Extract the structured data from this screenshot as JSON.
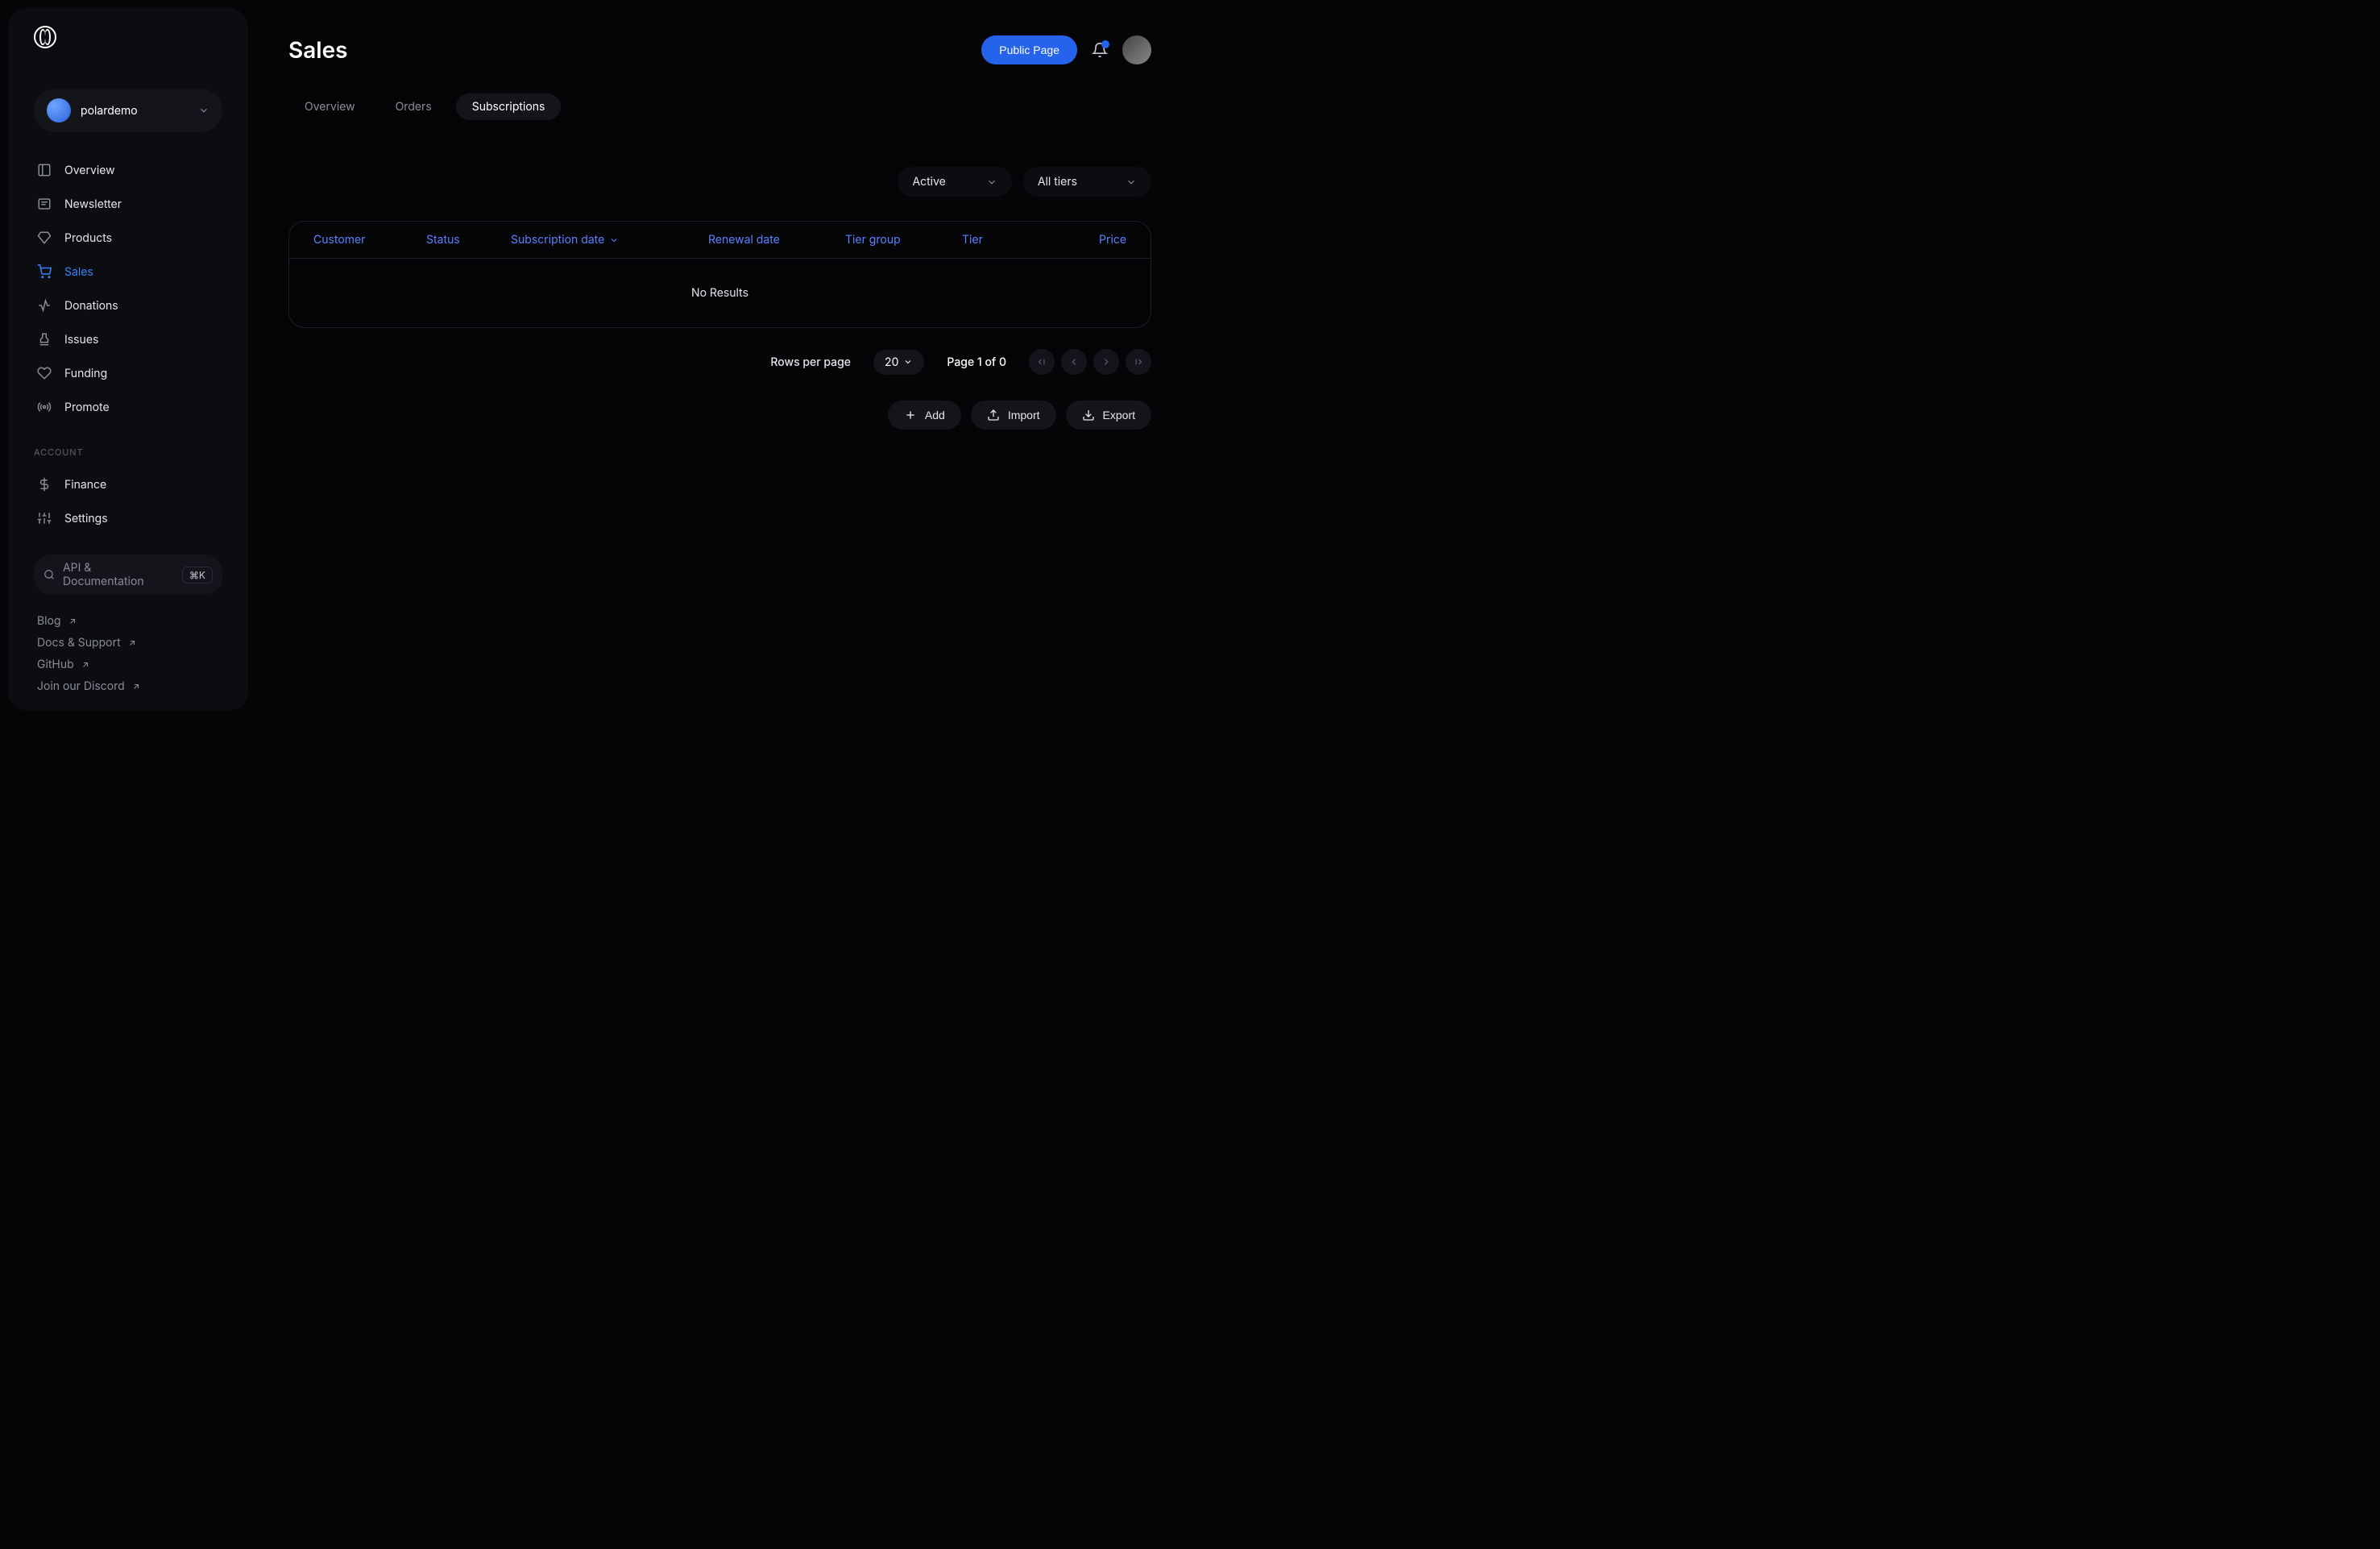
{
  "org_name": "polardemo",
  "sidebar": {
    "nav": [
      {
        "key": "overview",
        "label": "Overview"
      },
      {
        "key": "newsletter",
        "label": "Newsletter"
      },
      {
        "key": "products",
        "label": "Products"
      },
      {
        "key": "sales",
        "label": "Sales"
      },
      {
        "key": "donations",
        "label": "Donations"
      },
      {
        "key": "issues",
        "label": "Issues"
      },
      {
        "key": "funding",
        "label": "Funding"
      },
      {
        "key": "promote",
        "label": "Promote"
      }
    ],
    "account_label": "ACCOUNT",
    "account_nav": [
      {
        "key": "finance",
        "label": "Finance"
      },
      {
        "key": "settings",
        "label": "Settings"
      }
    ],
    "search_placeholder": "API & Documentation",
    "search_shortcut": "⌘K",
    "footer": [
      {
        "key": "blog",
        "label": "Blog"
      },
      {
        "key": "docs",
        "label": "Docs & Support"
      },
      {
        "key": "github",
        "label": "GitHub"
      },
      {
        "key": "discord",
        "label": "Join our Discord"
      }
    ]
  },
  "header": {
    "title": "Sales",
    "public_page_btn": "Public Page"
  },
  "tabs": [
    {
      "key": "overview",
      "label": "Overview"
    },
    {
      "key": "orders",
      "label": "Orders"
    },
    {
      "key": "subscriptions",
      "label": "Subscriptions"
    }
  ],
  "filters": {
    "status": "Active",
    "tiers": "All tiers"
  },
  "table": {
    "columns": {
      "customer": "Customer",
      "status": "Status",
      "subscription_date": "Subscription date",
      "renewal_date": "Renewal date",
      "tier_group": "Tier group",
      "tier": "Tier",
      "price": "Price"
    },
    "no_results": "No Results"
  },
  "pagination": {
    "rows_label": "Rows per page",
    "rows_value": "20",
    "page_info": "Page 1 of 0"
  },
  "actions": {
    "add": "Add",
    "import": "Import",
    "export": "Export"
  }
}
